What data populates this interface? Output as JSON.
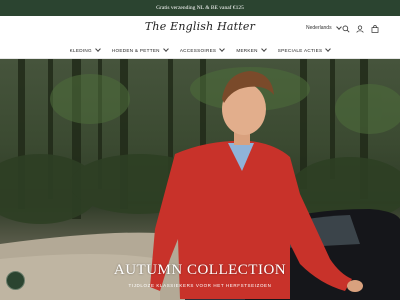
{
  "announcement": {
    "text": "Gratis verzending NL & BE vanaf €125"
  },
  "header": {
    "logo_text": "The English Hatter",
    "language": "Nederlands"
  },
  "icons": {
    "search": "search-icon",
    "account": "user-icon",
    "cart": "bag-icon",
    "language_chevron": "chevron-down-icon"
  },
  "nav": {
    "items": [
      {
        "label": "KLEDING"
      },
      {
        "label": "HOEDEN & PETTEN"
      },
      {
        "label": "ACCESSOIRES"
      },
      {
        "label": "MERKEN"
      },
      {
        "label": "SPECIALE ACTIES"
      }
    ]
  },
  "hero": {
    "title": "AUTUMN COLLECTION",
    "subtitle": "TIJDLOZE KLASSIEKERS VOOR HET HERFSTSEIZOEN"
  },
  "colors": {
    "brand_green": "#2b4430",
    "sweater_red": "#c8322a"
  }
}
